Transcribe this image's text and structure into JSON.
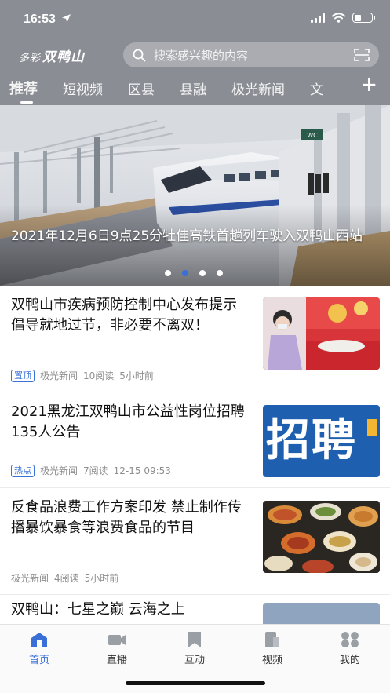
{
  "status_bar": {
    "time": "16:53"
  },
  "header": {
    "logo_small": "多彩",
    "logo_main": "双鸭山",
    "search_placeholder": "搜索感兴趣的内容"
  },
  "tabs": [
    {
      "label": "推荐",
      "active": true
    },
    {
      "label": "短视频"
    },
    {
      "label": "区县"
    },
    {
      "label": "县融"
    },
    {
      "label": "极光新闻"
    },
    {
      "label": "文"
    }
  ],
  "tabs_add": "+",
  "banner": {
    "caption": "2021年12月6日9点25分牡佳高铁首趟列车驶入双鸭山西站",
    "slide_count": 4,
    "active_slide": 2,
    "sign_text": "WC"
  },
  "feed": [
    {
      "title": "双鸭山市疾病预防控制中心发布提示 倡导就地过节，非必要不离双！",
      "badge": "置顶",
      "source": "极光新闻",
      "reads": "10阅读",
      "time": "5小时前"
    },
    {
      "title": "2021黑龙江双鸭山市公益性岗位招聘135人公告",
      "badge": "热点",
      "source": "极光新闻",
      "reads": "7阅读",
      "time": "12-15 09:53",
      "thumb_text": "招聘"
    },
    {
      "title": "反食品浪费工作方案印发 禁止制作传播暴饮暴食等浪费食品的节目",
      "source": "极光新闻",
      "reads": "4阅读",
      "time": "5小时前"
    },
    {
      "title": "双鸭山：七星之巅 云海之上"
    }
  ],
  "tabbar": [
    {
      "label": "首页",
      "icon": "home-icon",
      "active": true
    },
    {
      "label": "直播",
      "icon": "video-camera-icon"
    },
    {
      "label": "互动",
      "icon": "bookmark-icon"
    },
    {
      "label": "视频",
      "icon": "document-icon"
    },
    {
      "label": "我的",
      "icon": "profile-icon"
    }
  ],
  "colors": {
    "accent": "#3a6fd8",
    "header_bg": "#8a8d93"
  }
}
